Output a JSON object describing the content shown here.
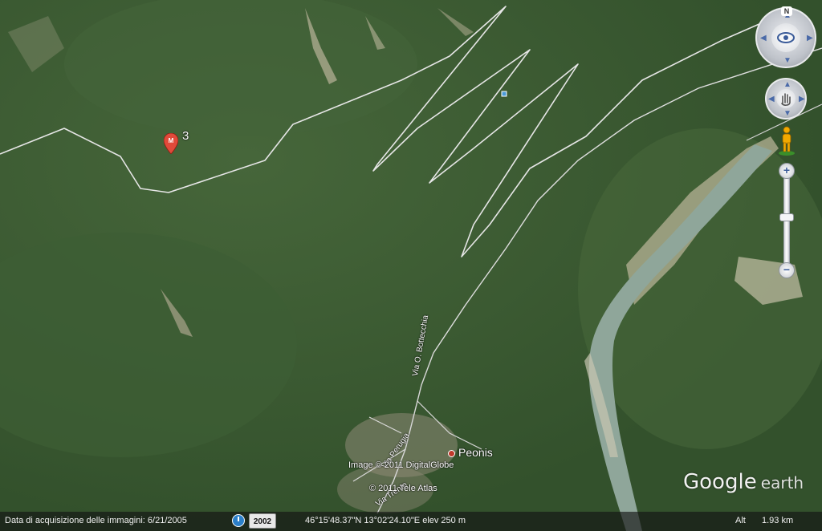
{
  "placemark": {
    "label": "3",
    "icon": "map-pin-icon",
    "glyph": "M"
  },
  "town": {
    "name": "Peonis"
  },
  "streets": [
    "Via O. Bottecchia",
    "Via Perugia",
    "Via Trento"
  ],
  "credits": {
    "imagery": "Image © 2011 DigitalGlobe",
    "data": "© 2011 Tele Atlas"
  },
  "logo": {
    "brand": "Google",
    "product": "earth"
  },
  "controls": {
    "north_label": "N",
    "look_icon": "eye-icon",
    "move_icon": "hand-icon",
    "pegman_icon": "pegman-icon",
    "zoom_in": "+",
    "zoom_out": "−"
  },
  "status_bar": {
    "imagery_date": "Data di acquisizione delle immagini: 6/21/2005",
    "year_button": "2002",
    "coordinates": "46°15'48.37\"N   13°02'24.10\"E  elev   250 m",
    "alt_label": "Alt",
    "alt_value": "1.93 km"
  },
  "colors": {
    "forest": "#3b5a32",
    "river": "#8fa69a",
    "road": "#e6e6e6",
    "pin": "#e04a3a"
  }
}
